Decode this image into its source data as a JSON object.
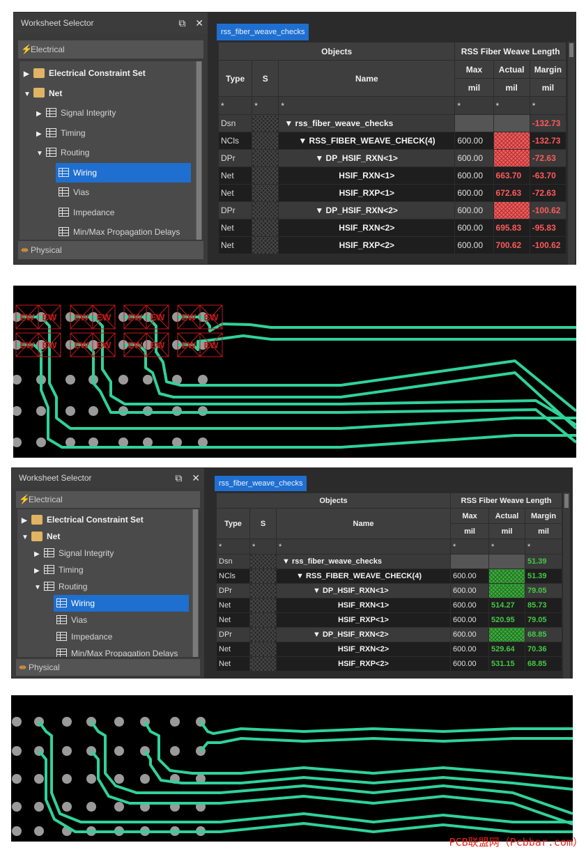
{
  "selector": {
    "title": "Worksheet Selector",
    "float_icon": "⧉",
    "close_icon": "✕",
    "electrical_label": "Electrical",
    "physical_label": "Physical",
    "tree": [
      {
        "label": "Electrical Constraint Set",
        "icon": "folder-icon",
        "expanded": false,
        "bold": true
      },
      {
        "label": "Net",
        "icon": "folder-icon",
        "expanded": true,
        "bold": true
      },
      {
        "label": "Signal Integrity",
        "icon": "worksheet-icon",
        "expanded": false
      },
      {
        "label": "Timing",
        "icon": "worksheet-icon",
        "expanded": false
      },
      {
        "label": "Routing",
        "icon": "worksheet-icon",
        "expanded": true
      },
      {
        "label": "Wiring",
        "icon": "grid-icon",
        "selected": true
      },
      {
        "label": "Vias",
        "icon": "grid-icon"
      },
      {
        "label": "Impedance",
        "icon": "grid-icon"
      },
      {
        "label": "Min/Max Propagation Delays",
        "icon": "grid-icon"
      }
    ]
  },
  "worksheet": {
    "tab_label": "rss_fiber_weave_checks",
    "headers": {
      "objects": "Objects",
      "group": "RSS Fiber Weave Length",
      "type": "Type",
      "s": "S",
      "name": "Name",
      "max": "Max",
      "actual": "Actual",
      "margin": "Margin",
      "unit": "mil",
      "filter": "*"
    }
  },
  "before_rows": [
    {
      "type": "Dsn",
      "name": "▼  rss_fiber_weave_checks",
      "max": "",
      "actual": "",
      "margin": "-132.73",
      "status": "fail"
    },
    {
      "type": "NCls",
      "name": "▼  RSS_FIBER_WEAVE_CHECK(4)",
      "max": "600.00",
      "actual": "",
      "margin": "-132.73",
      "status": "fail"
    },
    {
      "type": "DPr",
      "name": "▼  DP_HSIF_RXN<1>",
      "max": "600.00",
      "actual": "",
      "margin": "-72.63",
      "status": "fail"
    },
    {
      "type": "Net",
      "name": "HSIF_RXN<1>",
      "max": "600.00",
      "actual": "663.70",
      "margin": "-63.70",
      "status": "fail"
    },
    {
      "type": "Net",
      "name": "HSIF_RXP<1>",
      "max": "600.00",
      "actual": "672.63",
      "margin": "-72.63",
      "status": "fail"
    },
    {
      "type": "DPr",
      "name": "▼  DP_HSIF_RXN<2>",
      "max": "600.00",
      "actual": "",
      "margin": "-100.62",
      "status": "fail"
    },
    {
      "type": "Net",
      "name": "HSIF_RXN<2>",
      "max": "600.00",
      "actual": "695.83",
      "margin": "-95.83",
      "status": "fail"
    },
    {
      "type": "Net",
      "name": "HSIF_RXP<2>",
      "max": "600.00",
      "actual": "700.62",
      "margin": "-100.62",
      "status": "fail"
    }
  ],
  "after_rows": [
    {
      "type": "Dsn",
      "name": "▼  rss_fiber_weave_checks",
      "max": "",
      "actual": "",
      "margin": "51.39",
      "status": "pass"
    },
    {
      "type": "NCls",
      "name": "▼  RSS_FIBER_WEAVE_CHECK(4)",
      "max": "600.00",
      "actual": "",
      "margin": "51.39",
      "status": "pass"
    },
    {
      "type": "DPr",
      "name": "▼  DP_HSIF_RXN<1>",
      "max": "600.00",
      "actual": "",
      "margin": "79.05",
      "status": "pass"
    },
    {
      "type": "Net",
      "name": "HSIF_RXN<1>",
      "max": "600.00",
      "actual": "514.27",
      "margin": "85.73",
      "status": "pass"
    },
    {
      "type": "Net",
      "name": "HSIF_RXP<1>",
      "max": "600.00",
      "actual": "520.95",
      "margin": "79.05",
      "status": "pass"
    },
    {
      "type": "DPr",
      "name": "▼  DP_HSIF_RXN<2>",
      "max": "600.00",
      "actual": "",
      "margin": "68.85",
      "status": "pass"
    },
    {
      "type": "Net",
      "name": "HSIF_RXN<2>",
      "max": "600.00",
      "actual": "529.64",
      "margin": "70.36",
      "status": "pass"
    },
    {
      "type": "Net",
      "name": "HSIF_RXP<2>",
      "max": "600.00",
      "actual": "531.15",
      "margin": "68.85",
      "status": "pass"
    }
  ],
  "pcb": {
    "trace_color": "#2fd29b",
    "via_color": "#9a9a9a",
    "drc_color": "#c41a1a",
    "drc_marker_text": "EW"
  },
  "watermark": "PCB联盟网（Pcbbar.com）"
}
